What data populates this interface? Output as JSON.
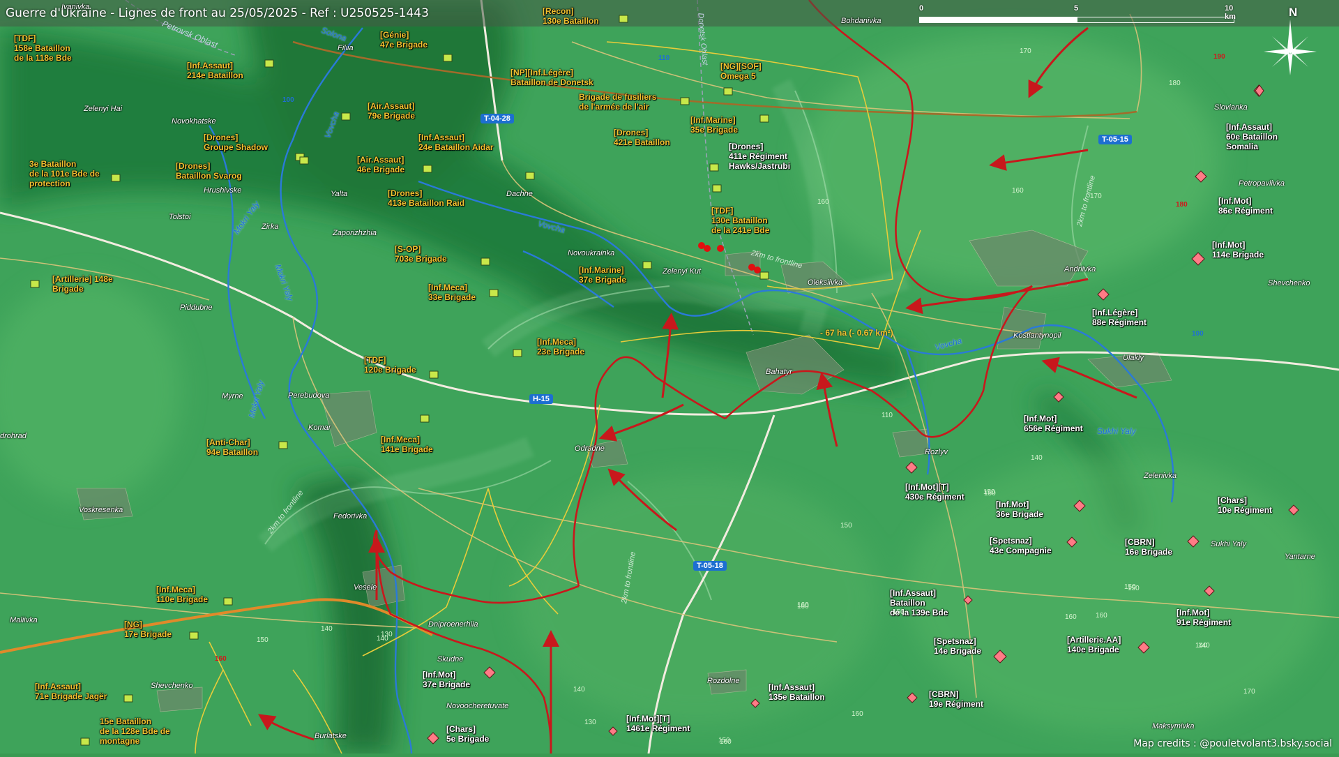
{
  "header": {
    "title": "Guerre d'Ukraine - Lignes de front au 25/05/2025 - Ref : U250525-1443",
    "scale_labels": [
      "0",
      "5",
      "10 km"
    ],
    "north_label": "N"
  },
  "credits": "Map credits : @pouletvolant3.bsky.social",
  "area_label": "- 67 ha (- 0.67 km²)",
  "colors": {
    "terrain_light": "#3faa5c",
    "terrain_dark": "#1f7a3a",
    "frontline": "#c8181c",
    "ukraine_unit": "#f2c230",
    "russia_unit": "#ff6f7e",
    "road_main": "#f2ece0",
    "river": "#2a7ad8"
  },
  "ua_units": [
    {
      "text": "[TDF]\n158e Bataillon\nde la 118e Bde"
    },
    {
      "text": "[Inf.Assaut]\n214e Bataillon"
    },
    {
      "text": "[Génie]\n47e Brigade"
    },
    {
      "text": "[Recon]\n130e Bataillon"
    },
    {
      "text": "[NP][Inf.Légère]\nBataillon de Donetsk"
    },
    {
      "text": "Brigade de fusiliers\nde l'armée de l'air"
    },
    {
      "text": "[NG][SOF]\nOmega 5"
    },
    {
      "text": "[Air.Assaut]\n79e Brigade"
    },
    {
      "text": "[Inf.Marine]\n35e Brigade"
    },
    {
      "text": "[Drones]\nGroupe Shadow"
    },
    {
      "text": "[Inf.Assaut]\n24e Bataillon Aidar"
    },
    {
      "text": "[Drones]\n421e Bataillon"
    },
    {
      "text": "3e Bataillon\nde la 101e Bde de\nprotection"
    },
    {
      "text": "[Drones]\nBataillon Svarog"
    },
    {
      "text": "[Air.Assaut]\n46e Brigade"
    },
    {
      "text": "[Drones]\n413e Bataillon Raid"
    },
    {
      "text": "[TDF]\n130e Bataillon\nde la 241e Bde"
    },
    {
      "text": "[S-OP]\n703e Brigade"
    },
    {
      "text": "[Artillerie] 148e\nBrigade"
    },
    {
      "text": "[Inf.Marine]\n37e Brigade"
    },
    {
      "text": "[Inf.Meca]\n33e Brigade"
    },
    {
      "text": "[Inf.Meca]\n23e Brigade"
    },
    {
      "text": "[TDF]\n120e Brigade"
    },
    {
      "text": "[Inf.Meca]\n141e Brigade"
    },
    {
      "text": "[Anti-Char]\n94e Bataillon"
    },
    {
      "text": "[Inf.Meca]\n110e Brigade"
    },
    {
      "text": "[NG]\n17e Brigade"
    },
    {
      "text": "[Inf.Assaut]\n71e Brigade Jagër"
    },
    {
      "text": "15e Bataillon\nde la 128e Bde de\nmontagne"
    }
  ],
  "ru_units": [
    {
      "text": "[Drones]\n411e Régiment\nHawks/Jastrubi"
    },
    {
      "text": "[Inf.Assaut]\n60e Bataillon\nSomalia"
    },
    {
      "text": "[Inf.Mot]\n86e Régiment"
    },
    {
      "text": "[Inf.Mot]\n114e Brigade"
    },
    {
      "text": "[Inf.Légère]\n88e Régiment"
    },
    {
      "text": "[Inf.Mot]\n656e Régiment"
    },
    {
      "text": "[Inf.Mot][T]\n430e Régiment"
    },
    {
      "text": "[Inf.Mot]\n36e Brigade"
    },
    {
      "text": "[Chars]\n10e Régiment"
    },
    {
      "text": "[Spetsnaz]\n43e Compagnie"
    },
    {
      "text": "[CBRN]\n16e Brigade"
    },
    {
      "text": "[Inf.Assaut]\nBataillon\nde la 139e Bde"
    },
    {
      "text": "[Inf.Mot]\n91e Régiment"
    },
    {
      "text": "[Spetsnaz]\n14e Brigade"
    },
    {
      "text": "[Artillerie.AA]\n140e Brigade"
    },
    {
      "text": "[Inf.Mot]\n37e Brigade"
    },
    {
      "text": "[CBRN]\n19e Régiment"
    },
    {
      "text": "[Inf.Assaut]\n135e Bataillon"
    },
    {
      "text": "[Chars]\n5e Brigade"
    },
    {
      "text": "[Inf.Mot][T]\n1461e Régiment"
    }
  ],
  "towns": [
    "Ivanivka",
    "Filiia",
    "Zelenyi Hai",
    "Novokhatske",
    "Hrushivske",
    "Yalta",
    "Dachne",
    "Tolstoi",
    "Zirka",
    "Zaporizhzhia",
    "Novoukrainka",
    "Zelenyi Kut",
    "Oleksiivka",
    "Andriivka",
    "Kostiantynopil",
    "Ulakly",
    "Shevchenko",
    "Bahatyr",
    "Piddubne",
    "Myrne",
    "Perebudova",
    "Komar",
    "Odradne",
    "Rozlyv",
    "drohrad",
    "Voskresenka",
    "Fedorivka",
    "Vesele",
    "Maliivka",
    "Dniproenerhiia",
    "Skudne",
    "Shevchenko",
    "Novoocheretuvate",
    "Burlatske",
    "Rozdolne",
    "Maksymivka",
    "Bohdanivka",
    "Slovianka",
    "Petropavlivka",
    "Zelenivka",
    "Sukhi Yaly",
    "Yantarne"
  ],
  "water_labels": [
    "Solona",
    "Vovcha",
    "Mokri Yaly",
    "Mokri Yaly",
    "Mokri Yaly",
    "Vovcha",
    "Vovcha",
    "Sukhi Yaly",
    "Petrovsk Oblast"
  ],
  "road_labels": [
    "T-04-28",
    "T-05-15",
    "H-15",
    "T-05-18"
  ],
  "route_numbers": [
    "100",
    "110",
    "100",
    "110"
  ],
  "frontline_labels": [
    "2km to frontline",
    "2km to frontline",
    "2km to frontline",
    "2km to frontline"
  ],
  "region_label": "Donetsk Oblast",
  "elevations": [
    "170",
    "180",
    "190",
    "160",
    "170",
    "180",
    "160",
    "160",
    "150",
    "150",
    "140",
    "150",
    "140",
    "160",
    "150",
    "140",
    "130",
    "150",
    "160",
    "160",
    "170",
    "140",
    "150",
    "160",
    "130",
    "150",
    "160",
    "140",
    "150",
    "140",
    "160"
  ]
}
